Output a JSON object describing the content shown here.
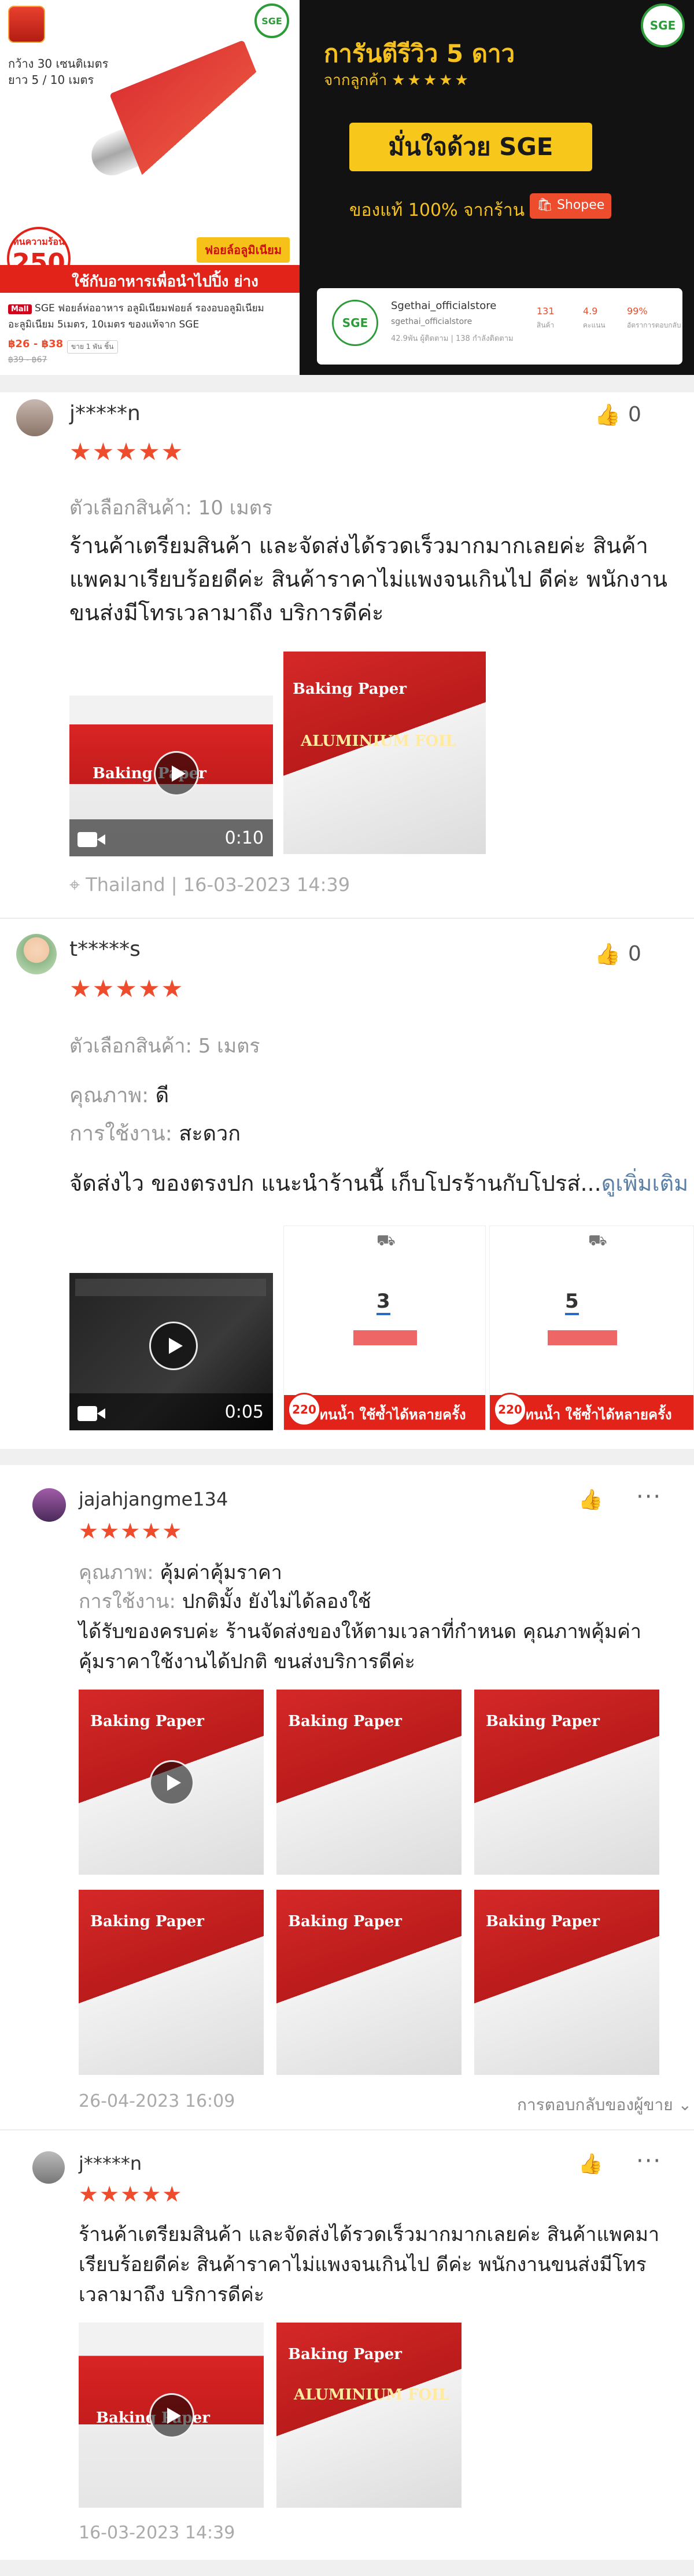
{
  "banner": {
    "left_size_text": "กว้าง 30 เซนติเมตร",
    "left_len_text": "ยาว 5 / 10 เมตร",
    "badge_top": "ทนความร้อน",
    "badge_value": "250",
    "foil_tag": "ฟอยล์อลูมิเนียม",
    "red_strip": "ใช้กับอาหารเพื่อนำไปปิ้ง ย่าง",
    "mall_tag": "Mall",
    "product_title": "SGE ฟอยล์ห่ออาหาร อลูมิเนียมฟอยล์ รองอบอลูมิเนียม อะลูมิเนียม 5เมตร, 10เมตร ของแท้จาก SGE",
    "price": "฿26 - ฿38",
    "price_old": "฿39 - ฿67",
    "sold": "ขาย 1 พัน ชิ้น",
    "guarantee": "การันตีรีวิว 5 ดาว",
    "from_customers": "จากลูกค้า",
    "trust_button": "มั่นใจด้วย SGE",
    "genuine": "ของแท้ 100% จากร้าน",
    "shopee": "Shopee",
    "sge_logo": "SGE",
    "store_name": "Sgethai_officialstore",
    "store_sub": "sgethai_officialstore",
    "store_rating_count": "131",
    "store_rating_count_label": "สินค้า",
    "store_score": "4.9",
    "store_score_label": "คะแนน",
    "store_response": "99%",
    "store_response_label": "อัตราการตอบกลับ",
    "store_meta": "42.9พัน ผู้ติดตาม  |  138 กำลังติดตาม"
  },
  "reviews": [
    {
      "name": "j*****n",
      "likes": "0",
      "variant": "ตัวเลือกสินค้า: 10 เมตร",
      "body": "ร้านค้าเตรียมสินค้า และจัดส่งได้รวดเร็วมากมากเลยค่ะ สินค้าแพคมาเรียบร้อยดีค่ะ  สินค้าราคาไม่แพงจนเกินไป ดีค่ะ พนักงานขนส่งมีโทรเวลามาถึง บริการดีค่ะ",
      "video_time": "0:10",
      "location_time": "Thailand | 16-03-2023 14:39",
      "pic_label_1": "Baking Paper",
      "pic_label_2": "ALUMINIUM FOIL"
    },
    {
      "name": "t*****s",
      "likes": "0",
      "variant": "ตัวเลือกสินค้า: 5 เมตร",
      "quality_label": "คุณภาพ:",
      "quality_value": "ดี",
      "usage_label": "การใช้งาน:",
      "usage_value": "สะดวก",
      "body": "จัดส่งไว ของตรงปก แนะนำร้านนี้ เก็บโปรร้านกับโปรส่...",
      "see_more": "ดูเพิ่มเติม",
      "video_time": "0:05",
      "promo_badge": "220",
      "promo_text": "ทนน้ำ ใช้ซ้ำได้หลายครั้ง",
      "pic_num_1": "3",
      "pic_num_2": "5"
    },
    {
      "name": "jajahjangme134",
      "quality_label": "คุณภาพ:",
      "quality_value": "คุ้มค่าคุ้มราคา",
      "usage_label": "การใช้งาน:",
      "usage_value": "ปกติมั้ง ยังไม่ได้ลองใช้",
      "body": "ได้รับของครบค่ะ ร้านจัดส่งของให้ตามเวลาที่กำหนด คุณภาพคุ้มค่าคุ้มราคาใช้งานได้ปกติ ขนส่งบริการดีค่ะ",
      "date": "26-04-2023 16:09",
      "reply": "การตอบกลับของผู้ขาย",
      "pic_label": "Baking Paper"
    },
    {
      "name": "j*****n",
      "body": "ร้านค้าเตรียมสินค้า และจัดส่งได้รวดเร็วมากมากเลยค่ะ สินค้าแพคมาเรียบร้อยดีค่ะ  สินค้าราคาไม่แพงจนเกินไป ดีค่ะ พนักงานขนส่งมีโทรเวลามาถึง บริการดีค่ะ",
      "date": "16-03-2023 14:39",
      "pic_label_1": "Baking Paper",
      "pic_label_2": "ALUMINIUM FOIL"
    }
  ],
  "icons": {
    "star": "★",
    "like": "thumbs-up-icon",
    "more": "more-dots-icon",
    "location": "location-pin-icon",
    "play": "play-icon",
    "video": "video-camera-icon"
  },
  "colors": {
    "accent": "#ee4d2d",
    "gold": "#f5c11e",
    "brand_green": "#2e9b3a"
  }
}
